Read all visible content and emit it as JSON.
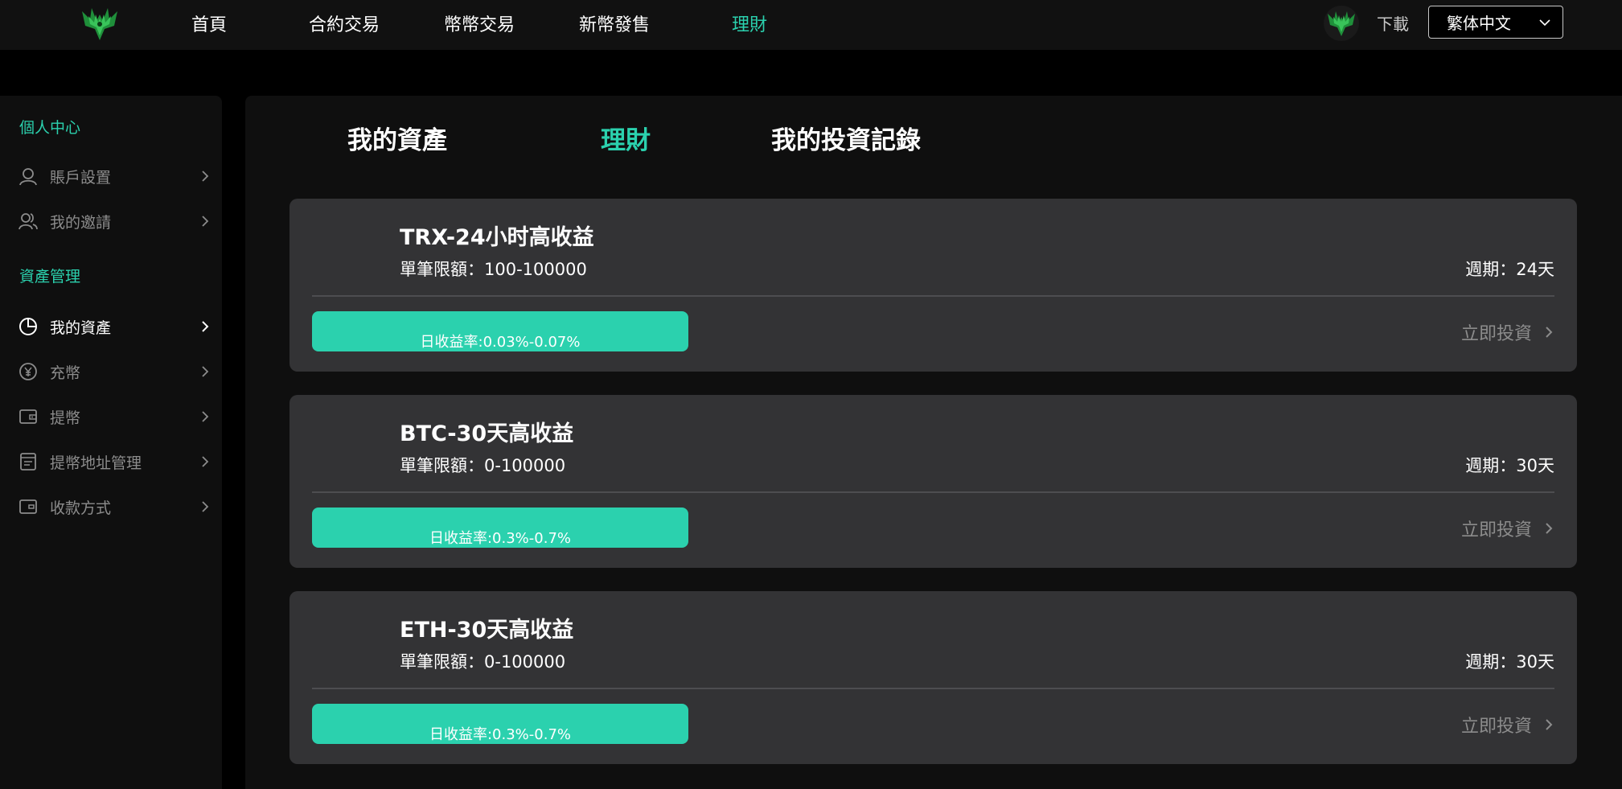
{
  "nav": {
    "items": [
      {
        "label": "首頁",
        "active": false
      },
      {
        "label": "合約交易",
        "active": false
      },
      {
        "label": "幣幣交易",
        "active": false
      },
      {
        "label": "新幣發售",
        "active": false
      },
      {
        "label": "理財",
        "active": true
      }
    ],
    "download_label": "下載",
    "language": "繁体中文"
  },
  "sidebar": {
    "sections": [
      {
        "title": "個人中心",
        "items": [
          {
            "label": "賬戶設置",
            "icon": "user-icon",
            "active": false
          },
          {
            "label": "我的邀請",
            "icon": "users-icon",
            "active": false
          }
        ]
      },
      {
        "title": "資產管理",
        "items": [
          {
            "label": "我的資產",
            "icon": "pie-chart-icon",
            "active": true
          },
          {
            "label": "充幣",
            "icon": "yen-coin-icon",
            "active": false
          },
          {
            "label": "提幣",
            "icon": "wallet-icon",
            "active": false
          },
          {
            "label": "提幣地址管理",
            "icon": "address-book-icon",
            "active": false
          },
          {
            "label": "收款方式",
            "icon": "card-wallet-icon",
            "active": false
          }
        ]
      }
    ]
  },
  "tabs": [
    {
      "label": "我的資產",
      "active": false
    },
    {
      "label": "理財",
      "active": true
    },
    {
      "label": "我的投資記錄",
      "active": false
    }
  ],
  "products": [
    {
      "title": "TRX-24小时高收益",
      "limit": "單筆限額：100-100000",
      "period": "週期：24天",
      "rate": "日收益率:0.03%-0.07%",
      "action": "立即投資"
    },
    {
      "title": "BTC-30天高收益",
      "limit": "單筆限額：0-100000",
      "period": "週期：30天",
      "rate": "日收益率:0.3%-0.7%",
      "action": "立即投資"
    },
    {
      "title": "ETH-30天高收益",
      "limit": "單筆限額：0-100000",
      "period": "週期：30天",
      "rate": "日收益率:0.3%-0.7%",
      "action": "立即投資"
    }
  ],
  "colors": {
    "accent": "#2bd1ae",
    "card_bg": "#333335",
    "panel_bg": "#0f0f0f",
    "muted_text": "#8c8c8c"
  }
}
